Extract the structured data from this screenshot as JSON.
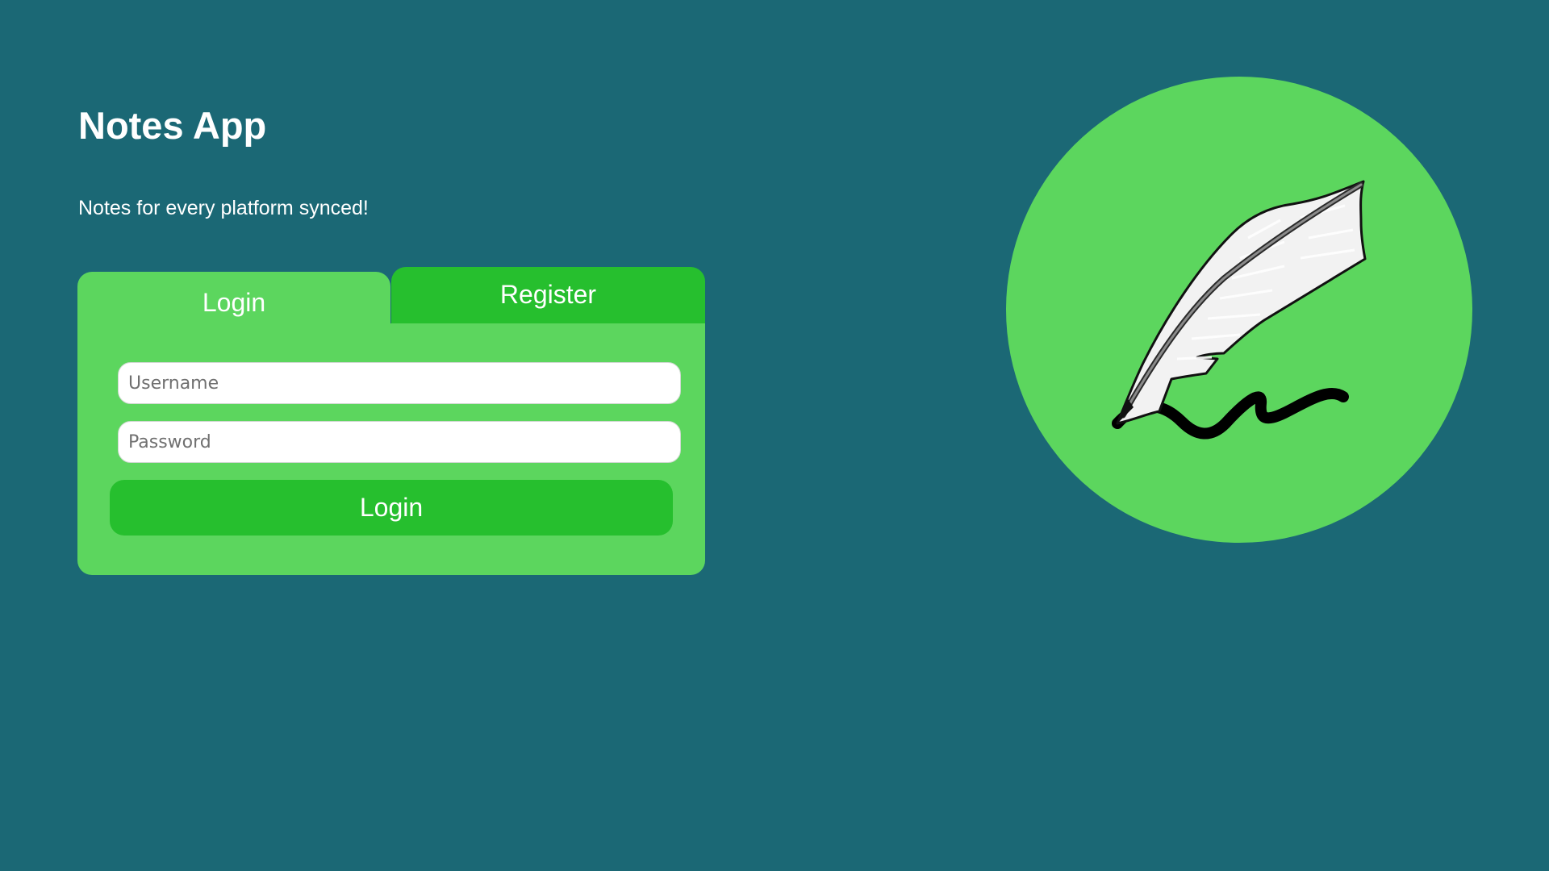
{
  "app": {
    "title": "Notes App",
    "tagline": "Notes for every platform synced!"
  },
  "auth": {
    "tabs": {
      "login_label": "Login",
      "register_label": "Register",
      "active": "login"
    },
    "form": {
      "username_placeholder": "Username",
      "username_value": "",
      "password_placeholder": "Password",
      "password_value": "",
      "submit_label": "Login"
    }
  },
  "logo": {
    "icon": "quill-pen-icon"
  },
  "colors": {
    "background": "#1b6875",
    "panel": "#5cd65e",
    "accent": "#26bf2e",
    "text": "#ffffff"
  }
}
